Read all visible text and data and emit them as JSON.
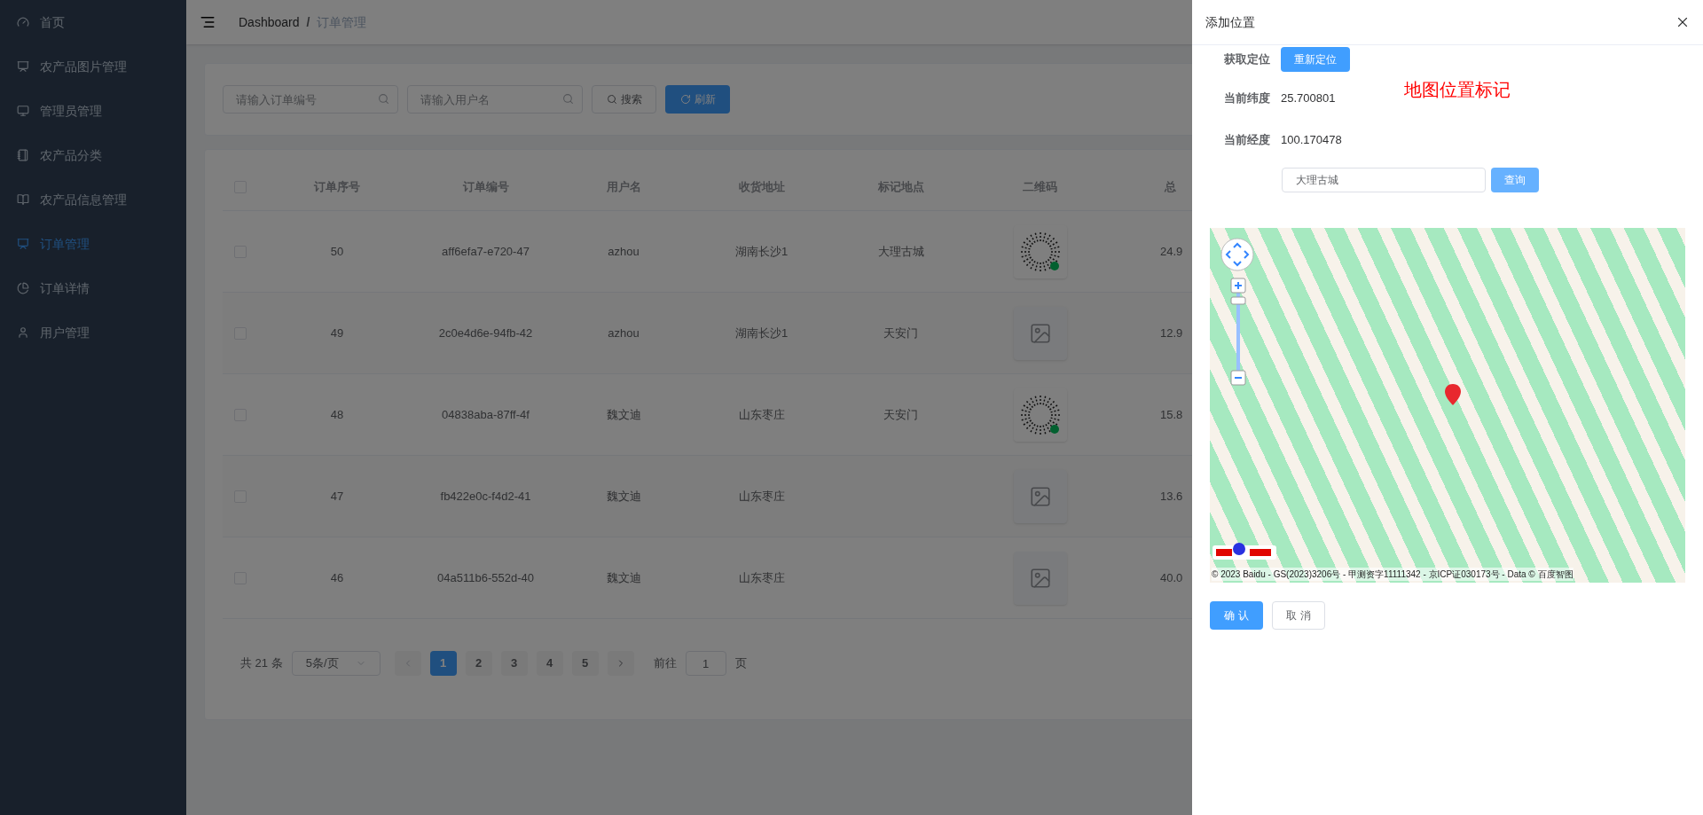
{
  "sidebar": {
    "items": [
      {
        "label": "首页",
        "selected": false
      },
      {
        "label": "农产品图片管理",
        "selected": false
      },
      {
        "label": "管理员管理",
        "selected": false
      },
      {
        "label": "农产品分类",
        "selected": false
      },
      {
        "label": "农产品信息管理",
        "selected": false
      },
      {
        "label": "订单管理",
        "selected": true
      },
      {
        "label": "订单详情",
        "selected": false
      },
      {
        "label": "用户管理",
        "selected": false
      }
    ]
  },
  "breadcrumb": [
    "Dashboard",
    "订单管理"
  ],
  "breadcrumb_separator": "/",
  "filters": {
    "order_no": {
      "placeholder": "请输入订单编号"
    },
    "username": {
      "placeholder": "请输入用户名"
    },
    "search_button": "搜索",
    "refresh_button": "刷新"
  },
  "table": {
    "select_all": {
      "checked": false
    },
    "columns": [
      "订单序号",
      "订单编号",
      "用户名",
      "收货地址",
      "标记地点",
      "二维码",
      "总"
    ],
    "rows": [
      {
        "checked": false,
        "id": "50",
        "order_no": "aff6efa7-e720-47",
        "username": "azhou",
        "address": "湖南长沙1",
        "place": "大理古城",
        "has_qr": true,
        "total": "24.9"
      },
      {
        "checked": false,
        "id": "49",
        "order_no": "2c0e4d6e-94fb-42",
        "username": "azhou",
        "address": "湖南长沙1",
        "place": "天安门",
        "has_qr": false,
        "total": "12.9"
      },
      {
        "checked": false,
        "id": "48",
        "order_no": "04838aba-87ff-4f",
        "username": "魏文迪",
        "address": "山东枣庄",
        "place": "天安门",
        "has_qr": true,
        "total": "15.8"
      },
      {
        "checked": false,
        "id": "47",
        "order_no": "fb422e0c-f4d2-41",
        "username": "魏文迪",
        "address": "山东枣庄",
        "place": "",
        "has_qr": false,
        "total": "13.6"
      },
      {
        "checked": false,
        "id": "46",
        "order_no": "04a511b6-552d-40",
        "username": "魏文迪",
        "address": "山东枣庄",
        "place": "",
        "has_qr": false,
        "total": "40.0"
      }
    ]
  },
  "pagination": {
    "total": "共 21 条",
    "page_size": "5条/页",
    "pages": [
      {
        "label": "1",
        "selected": true
      },
      {
        "label": "2",
        "selected": false
      },
      {
        "label": "3",
        "selected": false
      },
      {
        "label": "4",
        "selected": false
      },
      {
        "label": "5",
        "selected": false
      }
    ],
    "goto_label": "前往",
    "goto_value": "1",
    "goto_suffix": "页"
  },
  "drawer": {
    "title": "添加位置",
    "locate_label": "获取定位",
    "locate_button": "重新定位",
    "map_heading": "地图位置标记",
    "lat_label": "当前纬度",
    "lat_value": "25.700801",
    "lng_label": "当前经度",
    "lng_value": "100.170478",
    "search_value": "大理古城",
    "query_button": "查询",
    "map_attribution": "© 2023 Baidu - GS(2023)3206号 - 甲测资字11111342 - 京ICP证030173号 - Data © 百度智图",
    "confirm_button": "确 认",
    "cancel_button": "取 消"
  }
}
